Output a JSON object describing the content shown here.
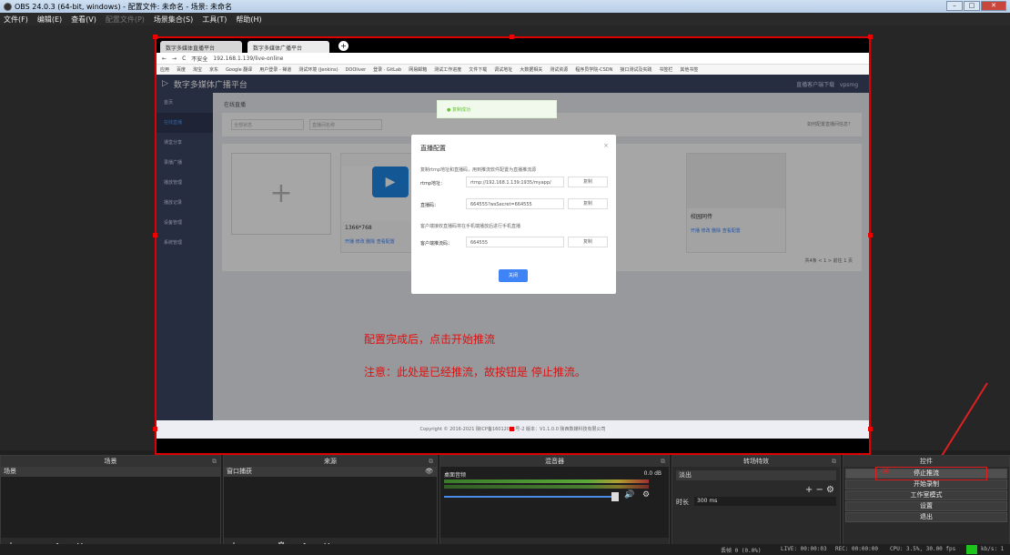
{
  "window": {
    "title": "OBS 24.0.3 (64-bit, windows) - 配置文件: 未命名 - 场景: 未命名",
    "min": "–",
    "max": "□",
    "close": "✕"
  },
  "menu": {
    "file": "文件(F)",
    "edit": "编辑(E)",
    "view": "查看(V)",
    "profile": "配置文件(P)",
    "scene_collection": "场景集合(S)",
    "tools": "工具(T)",
    "help": "帮助(H)"
  },
  "browser": {
    "tab1": "数字多媒体直播平台",
    "tab2": "数字多媒体广播平台",
    "insecure": "不安全",
    "url": "192.168.1.139/live-online",
    "bookmarks": [
      "应用",
      "百度",
      "淘宝",
      "京东",
      "Google 翻译",
      "用户登录 - 禅道",
      "测试环境 (Jenkins)",
      "DOOliver",
      "登录 · GitLab",
      "网易邮箱",
      "测试工作进度",
      "文件下载",
      "调试地址",
      "大数据相关",
      "测试资源",
      "程序员学院-CSDN",
      "接口测试及实践",
      "书签栏",
      "其他书签"
    ]
  },
  "app": {
    "title": "数字多媒体广播平台",
    "header_right": "直播客户端下载",
    "user": "vpsmg",
    "sidebar": [
      "首页",
      "在线直播",
      "课堂分享",
      "录播广播",
      "播放管理",
      "播放记录",
      "设备管理",
      "系统管理"
    ],
    "breadcrumb": "在线直播",
    "filter1": "全部状态",
    "filter2": "直播间名称",
    "filter_right": "如何配置直播间信息？",
    "toast": "复制成功",
    "tile1_name": "1366*768",
    "tile2_name": "校园同传",
    "tile_actions": "开播  修改  删除  查看配置",
    "pager": "共4条  <  1  >  前往  1  页",
    "footer": "Copyright © 2016-2021   陕ICP备16012031号-2  版本：V1.1.0.0  陕西数媒科技有限公司"
  },
  "dialog": {
    "title": "直播配置",
    "close": "×",
    "hint1": "复制rtmp地址和直播码，用到推流软件配置为直播推流源",
    "rtmp_label": "rtmp地址：",
    "rtmp_value": "rtmp://192.168.1.139:1935/myapp/",
    "key_label": "直播码：",
    "key_value": "664555?wsSecret=664555",
    "copy": "复制",
    "hint2": "客户端接收直播码将在手机端播放后进行手机直播",
    "client_label": "客户端推流码：",
    "client_value": "664555",
    "ok": "关闭"
  },
  "annotations": {
    "line1": "配置完成后，点击开始推流",
    "line2": "注意：此处是已经推流，故按钮是 停止推流。",
    "marker": "④"
  },
  "docks": {
    "scenes_title": "场景",
    "scenes": [
      "场景"
    ],
    "sources_title": "来源",
    "sources": [
      "窗口捕获"
    ],
    "mixer_title": "混音器",
    "mixer_track": "桌面音频",
    "mixer_db": "0.0 dB",
    "transitions_title": "转场特效",
    "transition": "淡出",
    "duration_label": "时长",
    "duration_value": "300 ms",
    "controls_title": "控件",
    "controls": [
      "停止推流",
      "开始录制",
      "工作室模式",
      "设置",
      "退出"
    ],
    "foot_scenes": "+ − ∧ ∨",
    "foot_sources": "+ − ⚙ ∧ ∨",
    "foot_transitions": "+ − ⚙"
  },
  "status": {
    "dropped": "丢帧 0 (0.0%)",
    "live": "LIVE: 00:00:03",
    "rec": "REC: 00:00:00",
    "cpu": "CPU: 3.5%, 30.00 fps",
    "kbs": "kb/s: 1"
  }
}
